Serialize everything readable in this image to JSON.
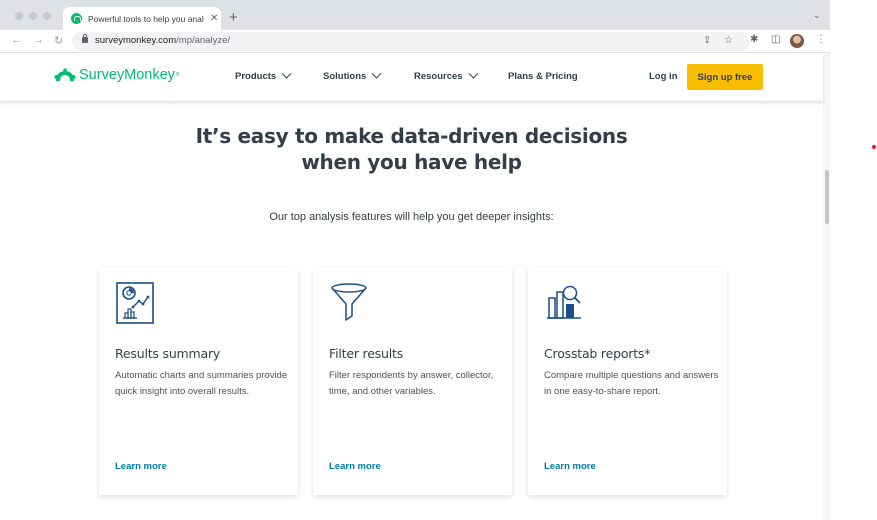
{
  "browser": {
    "tab_title": "Powerful tools to help you anal",
    "tab_close": "✕",
    "new_tab": "+",
    "tab_menu": "⌄",
    "url_domain": "surveymonkey.com",
    "url_path": "/mp/analyze/",
    "back": "←",
    "forward": "→",
    "reload": "↻",
    "share": "⇪",
    "bookmark": "☆",
    "extensions": "✱",
    "sidepanel": "◫",
    "menu": "⋮"
  },
  "header": {
    "logo_text": "SurveyMonkey",
    "logo_mark": "®",
    "nav": [
      {
        "label": "Products",
        "has_dropdown": true
      },
      {
        "label": "Solutions",
        "has_dropdown": true
      },
      {
        "label": "Resources",
        "has_dropdown": true
      },
      {
        "label": "Plans & Pricing",
        "has_dropdown": false
      }
    ],
    "login": "Log in",
    "signup": "Sign up free"
  },
  "main": {
    "headline_line1": "It’s easy to make data-driven decisions",
    "headline_line2": "when you have help",
    "subhead": "Our top analysis features will help you get deeper insights:",
    "cards": [
      {
        "icon": "results-summary-icon",
        "title": "Results summary",
        "description": "Automatic charts and summaries provide quick insight into overall results.",
        "link": "Learn more"
      },
      {
        "icon": "filter-funnel-icon",
        "title": "Filter results",
        "description": "Filter respondents by answer, collector, time, and other variables.",
        "link": "Learn more"
      },
      {
        "icon": "crosstab-chart-icon",
        "title": "Crosstab reports*",
        "description": "Compare multiple questions and answers in one easy-to-share report.",
        "link": "Learn more"
      }
    ]
  },
  "colors": {
    "brand_green": "#00bf6f",
    "signup_yellow": "#f9be00",
    "text_dark": "#333e48",
    "link_blue": "#007faa",
    "icon_navy": "#1b4f86"
  }
}
